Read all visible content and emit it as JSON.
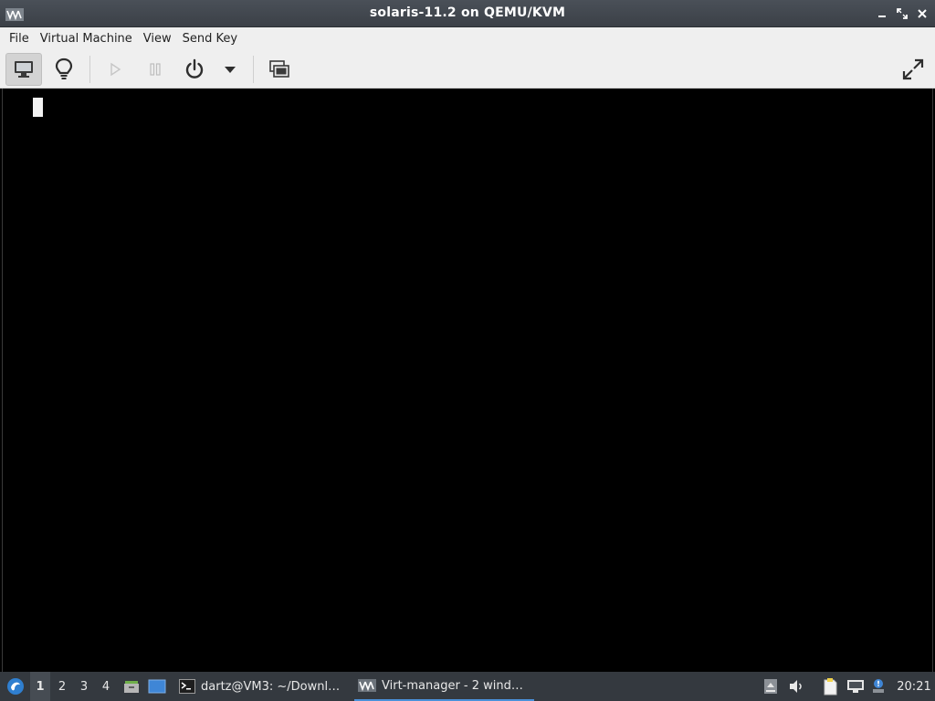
{
  "window": {
    "title": "solaris-11.2 on QEMU/KVM"
  },
  "menu": {
    "items": [
      "File",
      "Virtual Machine",
      "View",
      "Send Key"
    ]
  },
  "toolbar": {
    "buttons": [
      "console-view",
      "details-view",
      "run",
      "pause",
      "shutdown",
      "shutdown-menu",
      "snapshots",
      "fullscreen"
    ]
  },
  "taskbar": {
    "workspaces": [
      "1",
      "2",
      "3",
      "4"
    ],
    "active_workspace": "1",
    "tasks": [
      {
        "label": "dartz@VM3: ~/Downl…",
        "icon": "terminal-icon"
      },
      {
        "label": "Virt-manager - 2 wind…",
        "icon": "virt-manager-icon"
      }
    ],
    "clock": "20:21"
  },
  "colors": {
    "accent": "#4a90d9",
    "titlebar": "#3f444b",
    "taskbar": "#34393f",
    "console": "#000000"
  }
}
